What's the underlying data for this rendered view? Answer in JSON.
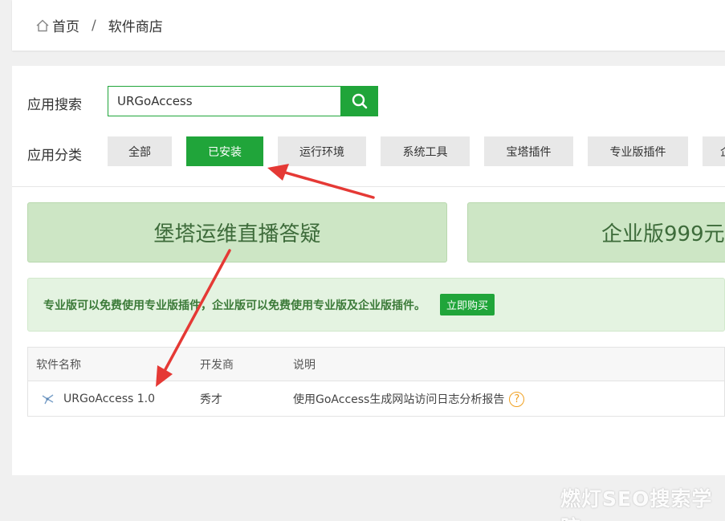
{
  "breadcrumb": {
    "home": "首页",
    "separator": "/",
    "current": "软件商店"
  },
  "search": {
    "label": "应用搜索",
    "value": "URGoAccess"
  },
  "category": {
    "label": "应用分类",
    "items": [
      "全部",
      "已安装",
      "运行环境",
      "系统工具",
      "宝塔插件",
      "专业版插件",
      "企"
    ],
    "active_index": 1
  },
  "banners": [
    "堡塔运维直播答疑",
    "企业版999元"
  ],
  "notice": {
    "text": "专业版可以免费使用专业版插件，企业版可以免费使用专业版及企业版插件。",
    "button": "立即购买"
  },
  "table": {
    "headers": [
      "软件名称",
      "开发商",
      "说明"
    ],
    "rows": [
      {
        "name": "URGoAccess 1.0",
        "developer": "秀才",
        "description": "使用GoAccess生成网站访问日志分析报告",
        "help": "?"
      }
    ]
  },
  "watermark": "燃灯SEO搜索学院",
  "colors": {
    "accent": "#20a53a",
    "arrow": "#e53935",
    "banner": "#cde6c5",
    "help": "#f0a020"
  }
}
